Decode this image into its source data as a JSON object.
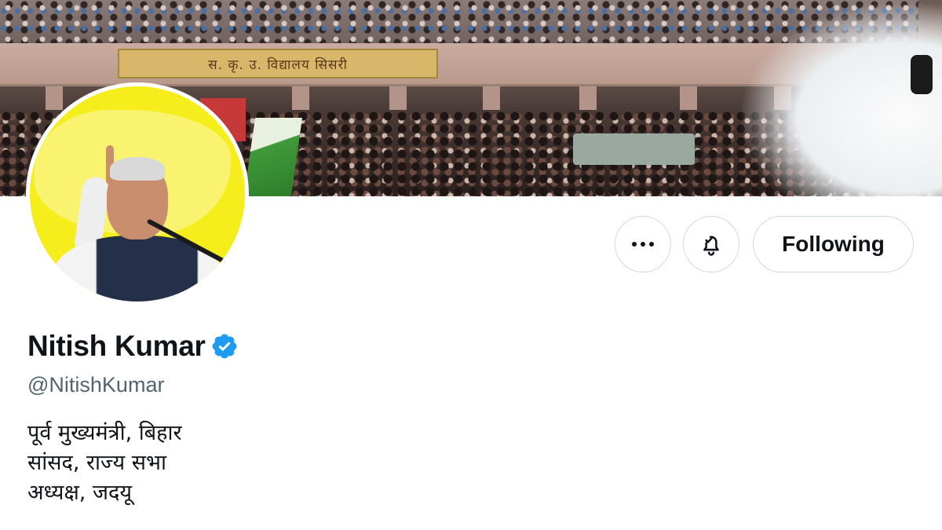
{
  "profile": {
    "name": "Nitish Kumar",
    "handle": "@NitishKumar",
    "verified": true,
    "bio_lines": [
      "पूर्व मुख्यमंत्री, बिहार",
      "सांसद, राज्य सभा",
      "अध्यक्ष, जदयू"
    ]
  },
  "banner": {
    "sign_text": "स. कृ. उ. विद्यालय सिसरी"
  },
  "actions": {
    "more_icon": "more-horizontal-icon",
    "notify_icon": "bell-check-icon",
    "following_label": "Following"
  },
  "colors": {
    "verified_badge": "#1d9bf0",
    "text_primary": "#0f1419",
    "text_secondary": "#536471",
    "border": "#cfd9de",
    "avatar_background": "#f6ee1c"
  }
}
